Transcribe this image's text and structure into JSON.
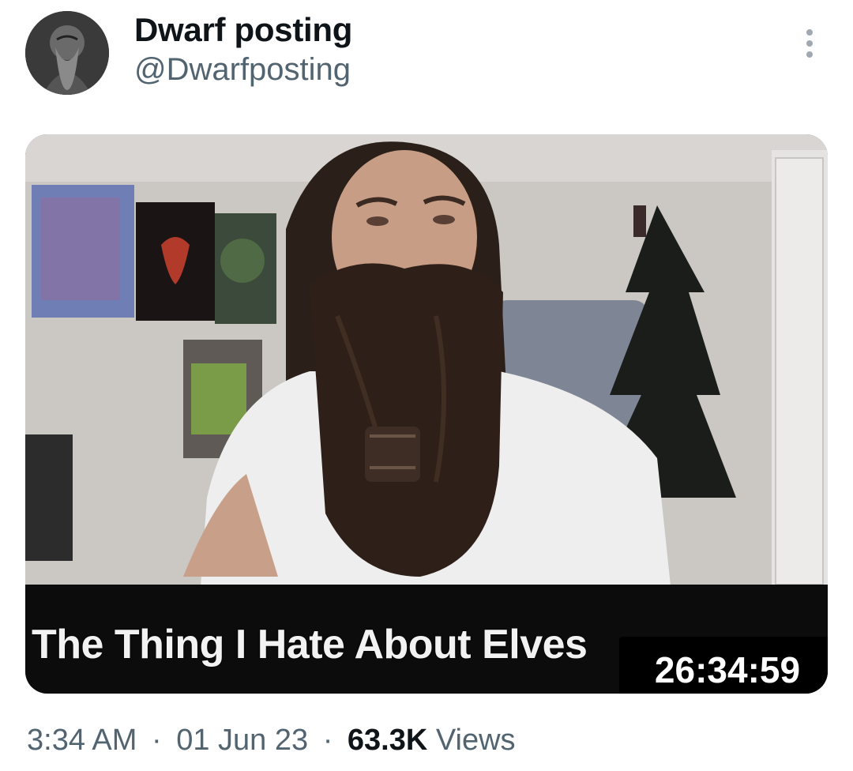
{
  "tweet": {
    "author": {
      "display_name": "Dwarf posting",
      "handle": "@Dwarfposting"
    },
    "more_icon": "more-vertical-icon",
    "media": {
      "duration": "26:34:59",
      "title": "The Thing I Hate About Elves"
    },
    "meta": {
      "time": "3:34 AM",
      "separator": "·",
      "date": "01 Jun 23",
      "views_count": "63.3K",
      "views_label": "Views"
    }
  },
  "colors": {
    "text_primary": "#0f1419",
    "text_secondary": "#536471",
    "background": "#ffffff"
  }
}
